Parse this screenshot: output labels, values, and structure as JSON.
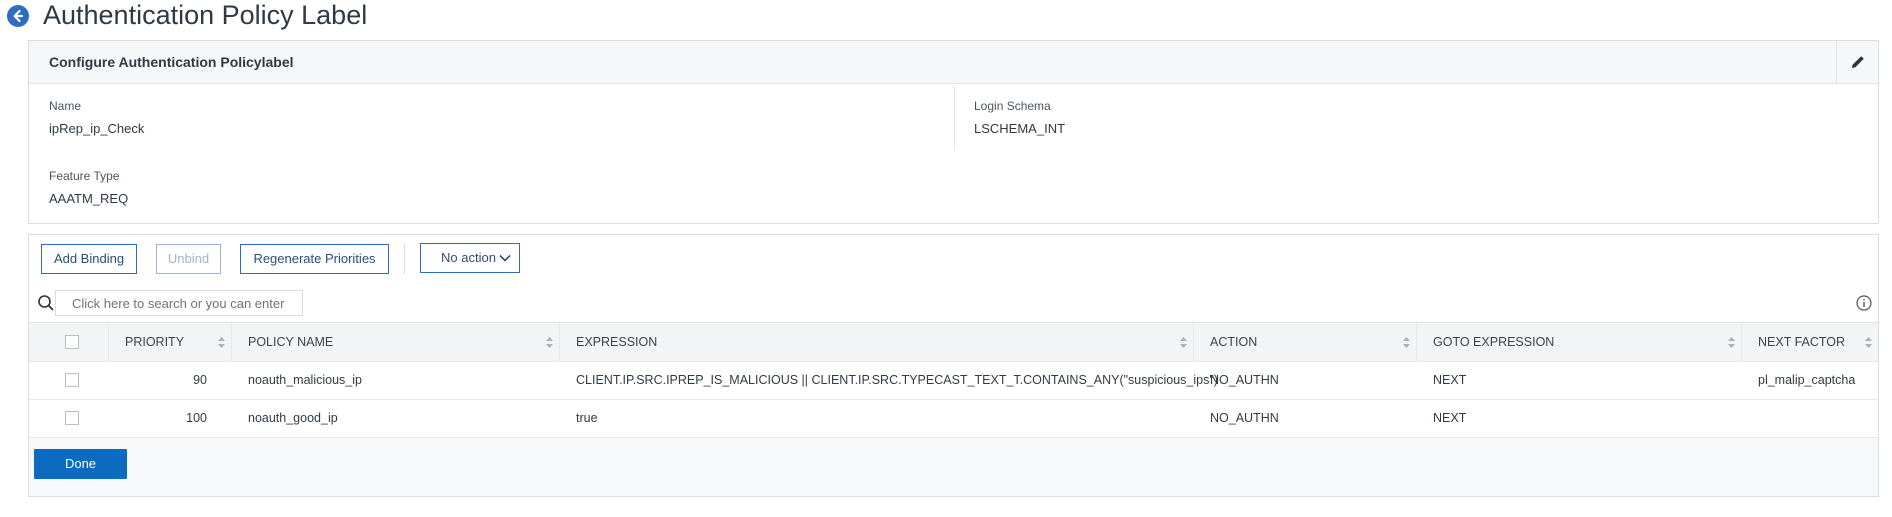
{
  "header": {
    "title": "Authentication Policy Label"
  },
  "config": {
    "title": "Configure Authentication Policylabel",
    "name_label": "Name",
    "name_value": "ipRep_ip_Check",
    "schema_label": "Login Schema",
    "schema_value": "LSCHEMA_INT",
    "feature_label": "Feature Type",
    "feature_value": "AAATM_REQ"
  },
  "toolbar": {
    "add_binding": "Add Binding",
    "unbind": "Unbind",
    "regenerate": "Regenerate Priorities",
    "action_select": "No action"
  },
  "search": {
    "placeholder": "Click here to search or you can enter Key : Value format"
  },
  "table": {
    "columns": [
      "PRIORITY",
      "POLICY NAME",
      "EXPRESSION",
      "ACTION",
      "GOTO EXPRESSION",
      "NEXT FACTOR"
    ],
    "rows": [
      {
        "priority": "90",
        "policy_name": "noauth_malicious_ip",
        "expression": "CLIENT.IP.SRC.IPREP_IS_MALICIOUS || CLIENT.IP.SRC.TYPECAST_TEXT_T.CONTAINS_ANY(\"suspicious_ips\")",
        "action": "NO_AUTHN",
        "goto": "NEXT",
        "next_factor": "pl_malip_captcha"
      },
      {
        "priority": "100",
        "policy_name": "noauth_good_ip",
        "expression": "true",
        "action": "NO_AUTHN",
        "goto": "NEXT",
        "next_factor": ""
      }
    ]
  },
  "footer": {
    "done": "Done"
  },
  "colors": {
    "accent": "#2d6cc0",
    "primary_button": "#0b6bc0"
  }
}
